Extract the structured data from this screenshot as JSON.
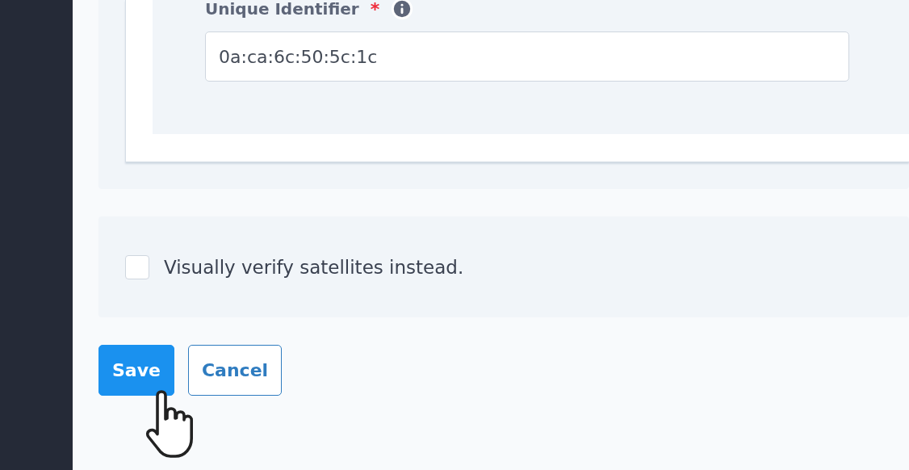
{
  "form": {
    "field": {
      "label": "Unique Identifier",
      "required_mark": "*",
      "value": "0a:ca:6c:50:5c:1c"
    },
    "checkbox": {
      "label": "Visually verify satellites instead.",
      "checked": false
    },
    "buttons": [
      {
        "label": "Save",
        "kind": "primary"
      },
      {
        "label": "Cancel",
        "kind": "secondary"
      }
    ]
  }
}
